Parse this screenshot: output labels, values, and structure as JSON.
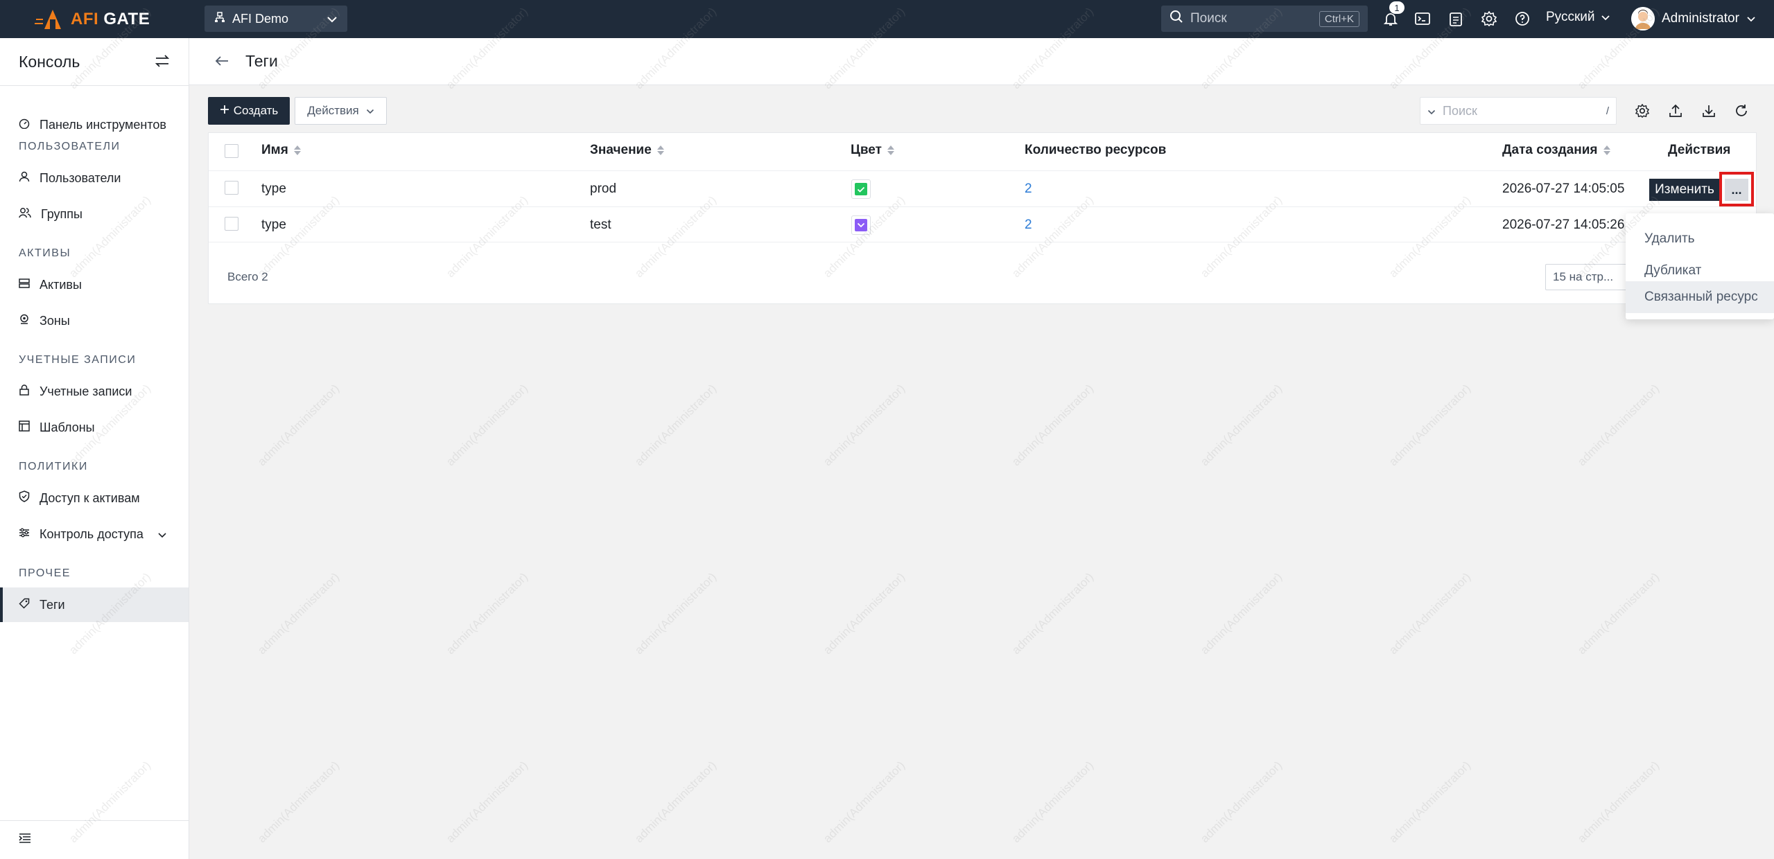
{
  "topbar": {
    "logo_prefix": "AFI",
    "logo_suffix": " GATE",
    "org_name": "AFI Demo",
    "search_placeholder": "Поиск",
    "search_shortcut": "Ctrl+K",
    "notification_count": "1",
    "language": "Русский",
    "user_name": "Administrator"
  },
  "sidebar": {
    "title": "Консоль",
    "items": [
      {
        "label": "Панель инструментов",
        "icon": "dashboard-icon"
      },
      {
        "section": "ПОЛЬЗОВАТЕЛИ"
      },
      {
        "label": "Пользователи",
        "icon": "user-icon"
      },
      {
        "label": "Группы",
        "icon": "group-icon"
      },
      {
        "section": "АКТИВЫ"
      },
      {
        "label": "Активы",
        "icon": "server-icon"
      },
      {
        "label": "Зоны",
        "icon": "location-icon"
      },
      {
        "section": "УЧЕТНЫЕ ЗАПИСИ"
      },
      {
        "label": "Учетные записи",
        "icon": "lock-icon"
      },
      {
        "label": "Шаблоны",
        "icon": "template-icon"
      },
      {
        "section": "ПОЛИТИКИ"
      },
      {
        "label": "Доступ к активам",
        "icon": "shield-icon"
      },
      {
        "label": "Контроль доступа",
        "icon": "access-control-icon"
      },
      {
        "section": "ПРОЧЕЕ"
      },
      {
        "label": "Теги",
        "icon": "tag-icon",
        "active": true
      }
    ]
  },
  "page": {
    "title": "Теги"
  },
  "toolbar": {
    "create_label": "Создать",
    "actions_label": "Действия",
    "search_placeholder": "Поиск",
    "search_shortcut": "/"
  },
  "table": {
    "columns": {
      "name": "Имя",
      "value": "Значение",
      "color": "Цвет",
      "resource_count": "Количество ресурсов",
      "created": "Дата создания",
      "actions": "Действия"
    },
    "rows": [
      {
        "name": "type",
        "value": "prod",
        "color": "#22c55e",
        "resource_count": "2",
        "created": "2026-07-27 14:05:05"
      },
      {
        "name": "type",
        "value": "test",
        "color": "#8b5cf6",
        "resource_count": "2",
        "created": "2026-07-27 14:05:26"
      }
    ],
    "edit_label": "Изменить",
    "more_label": "...",
    "total": "Всего 2",
    "page_size": "15 на стр..."
  },
  "dropdown": {
    "items": [
      "Удалить",
      "Дубликат",
      "Связанный ресурс"
    ]
  },
  "watermark": "admin(Administrator)",
  "colors": {
    "topbar_bg": "#1f2b3a",
    "brand_accent": "#f07d1a",
    "link": "#2b7bd6",
    "highlight_border": "#e01c1c"
  }
}
